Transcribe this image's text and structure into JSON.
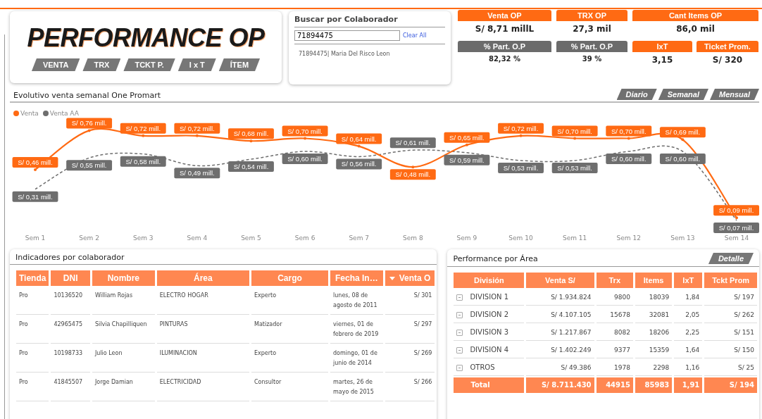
{
  "header": {
    "title": "PERFORMANCE OP",
    "tabs": [
      "VENTA",
      "TRX",
      "TCKT P.",
      "I x T",
      "ÍTEM"
    ]
  },
  "search": {
    "label": "Buscar por Colaborador",
    "value": "71894475",
    "clear_link": "Clear All",
    "results": [
      "71894475| Maria Del Risco Leon"
    ]
  },
  "kpi_columns": [
    {
      "cards": [
        {
          "label": "Venta OP",
          "value": "S/ 8,71 millL",
          "kind": "primary"
        },
        {
          "label": "% Part. O.P",
          "value": "82,32 %",
          "kind": "secondary"
        }
      ]
    },
    {
      "cards": [
        {
          "label": "TRX OP",
          "value": "27,3 mil",
          "kind": "primary"
        },
        {
          "label": "% Part. O.P",
          "value": "39 %",
          "kind": "secondary"
        }
      ]
    },
    {
      "cards": [
        {
          "label": "Cant Items OP",
          "value": "86,0 mil",
          "kind": "primary"
        }
      ],
      "split": [
        {
          "label": "IxT",
          "value": "3,15",
          "kind": "primary"
        },
        {
          "label": "Ticket Prom.",
          "value": "S/ 320",
          "kind": "primary"
        }
      ]
    }
  ],
  "trend": {
    "title": "Evolutivo venta semanal One Promart",
    "periods": [
      "Diario",
      "Semanal",
      "Mensual"
    ],
    "chart_data": {
      "type": "line",
      "categories": [
        "Sem 1",
        "Sem 2",
        "Sem 3",
        "Sem 4",
        "Sem 5",
        "Sem 6",
        "Sem 7",
        "Sem 8",
        "Sem 9",
        "Sem 10",
        "Sem 11",
        "Sem 12",
        "Sem 13",
        "Sem 14"
      ],
      "data_labels": true,
      "series": [
        {
          "name": "Venta",
          "color": "#ff6a13",
          "line_style": "solid",
          "values": [
            0.46,
            0.76,
            0.72,
            0.72,
            0.68,
            0.7,
            0.64,
            0.48,
            0.65,
            0.72,
            0.7,
            0.7,
            0.69,
            0.09
          ],
          "value_labels": [
            "S/ 0,46 mill.",
            "S/ 0,76 mill.",
            "S/ 0,72 mill.",
            "S/ 0,72 mill.",
            "S/ 0,68 mill.",
            "S/ 0,70 mill.",
            "S/ 0,64 mill.",
            "S/ 0,48 mill.",
            "S/ 0,65 mill.",
            "S/ 0,72 mill.",
            "S/ 0,70 mill.",
            "S/ 0,70 mill.",
            "S/ 0,69 mill.",
            "S/ 0,09 mill."
          ]
        },
        {
          "name": "Venta AA",
          "color": "#6e6e6e",
          "line_style": "dashed",
          "values": [
            0.31,
            0.55,
            0.58,
            0.49,
            0.54,
            0.6,
            0.56,
            0.61,
            0.59,
            0.53,
            0.53,
            0.6,
            0.6,
            0.07
          ],
          "value_labels": [
            "S/ 0,31 mill.",
            "S/ 0,55 mill.",
            "S/ 0,58 mill.",
            "S/ 0,49 mill.",
            "S/ 0,54 mill.",
            "S/ 0,60 mill.",
            "S/ 0,56 mill.",
            "S/ 0,61 mill.",
            "S/ 0,59 mill.",
            "S/ 0,53 mill.",
            "S/ 0,53 mill.",
            "S/ 0,60 mill.",
            "S/ 0,60 mill.",
            "S/ 0,07 mill."
          ]
        }
      ]
    }
  },
  "collaborators": {
    "title": "Indicadores por colaborador",
    "columns": [
      {
        "label": "Tienda",
        "sorted": false
      },
      {
        "label": "DNI",
        "sorted": false
      },
      {
        "label": "Nombre",
        "sorted": false
      },
      {
        "label": "Área",
        "sorted": false
      },
      {
        "label": "Cargo",
        "sorted": false
      },
      {
        "label": "Fecha In…",
        "sorted": false
      },
      {
        "label": "Venta O",
        "sorted": true
      }
    ],
    "rows": [
      [
        "Pro",
        "10136520",
        "William Rojas",
        "ELECTRO HOGAR",
        "Experto",
        "lunes, 08 de agosto de 2011",
        "S/ 301"
      ],
      [
        "Pro",
        "42965475",
        "Silvia Chapilliquen",
        "PINTURAS",
        "Matizador",
        "viernes, 01 de febrero de 2019",
        "S/ 297"
      ],
      [
        "Pro",
        "10198733",
        "Julio Leon",
        "ILUMINACION",
        "Experto",
        "domingo, 01 de junio de 2014",
        "S/ 269"
      ],
      [
        "Pro",
        "41845507",
        "Jorge Damian",
        "ELECTRICIDAD",
        "Consultor",
        "martes, 26 de mayo de 2015",
        "S/ 266"
      ]
    ]
  },
  "areas": {
    "title": "Performance por Área",
    "detail_button": "Detalle",
    "columns": [
      "División",
      "Venta S/",
      "Trx",
      "Items",
      "IxT",
      "Tckt Prom"
    ],
    "rows": [
      {
        "expanded": false,
        "cells": [
          "DIVISION 1",
          "S/ 1.934.824",
          "9800",
          "18039",
          "1,84",
          "S/ 197"
        ]
      },
      {
        "expanded": false,
        "cells": [
          "DIVISION 2",
          "S/ 4.107.105",
          "15678",
          "32081",
          "2,05",
          "S/ 262"
        ]
      },
      {
        "expanded": false,
        "cells": [
          "DIVISION 3",
          "S/ 1.217.867",
          "8082",
          "18206",
          "2,25",
          "S/ 151"
        ]
      },
      {
        "expanded": false,
        "cells": [
          "DIVISION 4",
          "S/ 1.402.249",
          "9377",
          "15359",
          "1,64",
          "S/ 150"
        ]
      },
      {
        "expanded": false,
        "cells": [
          "OTROS",
          "S/ 49.386",
          "1978",
          "2298",
          "1,16",
          "S/ 25"
        ]
      }
    ],
    "total": [
      "Total",
      "S/ 8.711.430",
      "44915",
      "85983",
      "1,91",
      "S/ 194"
    ]
  }
}
